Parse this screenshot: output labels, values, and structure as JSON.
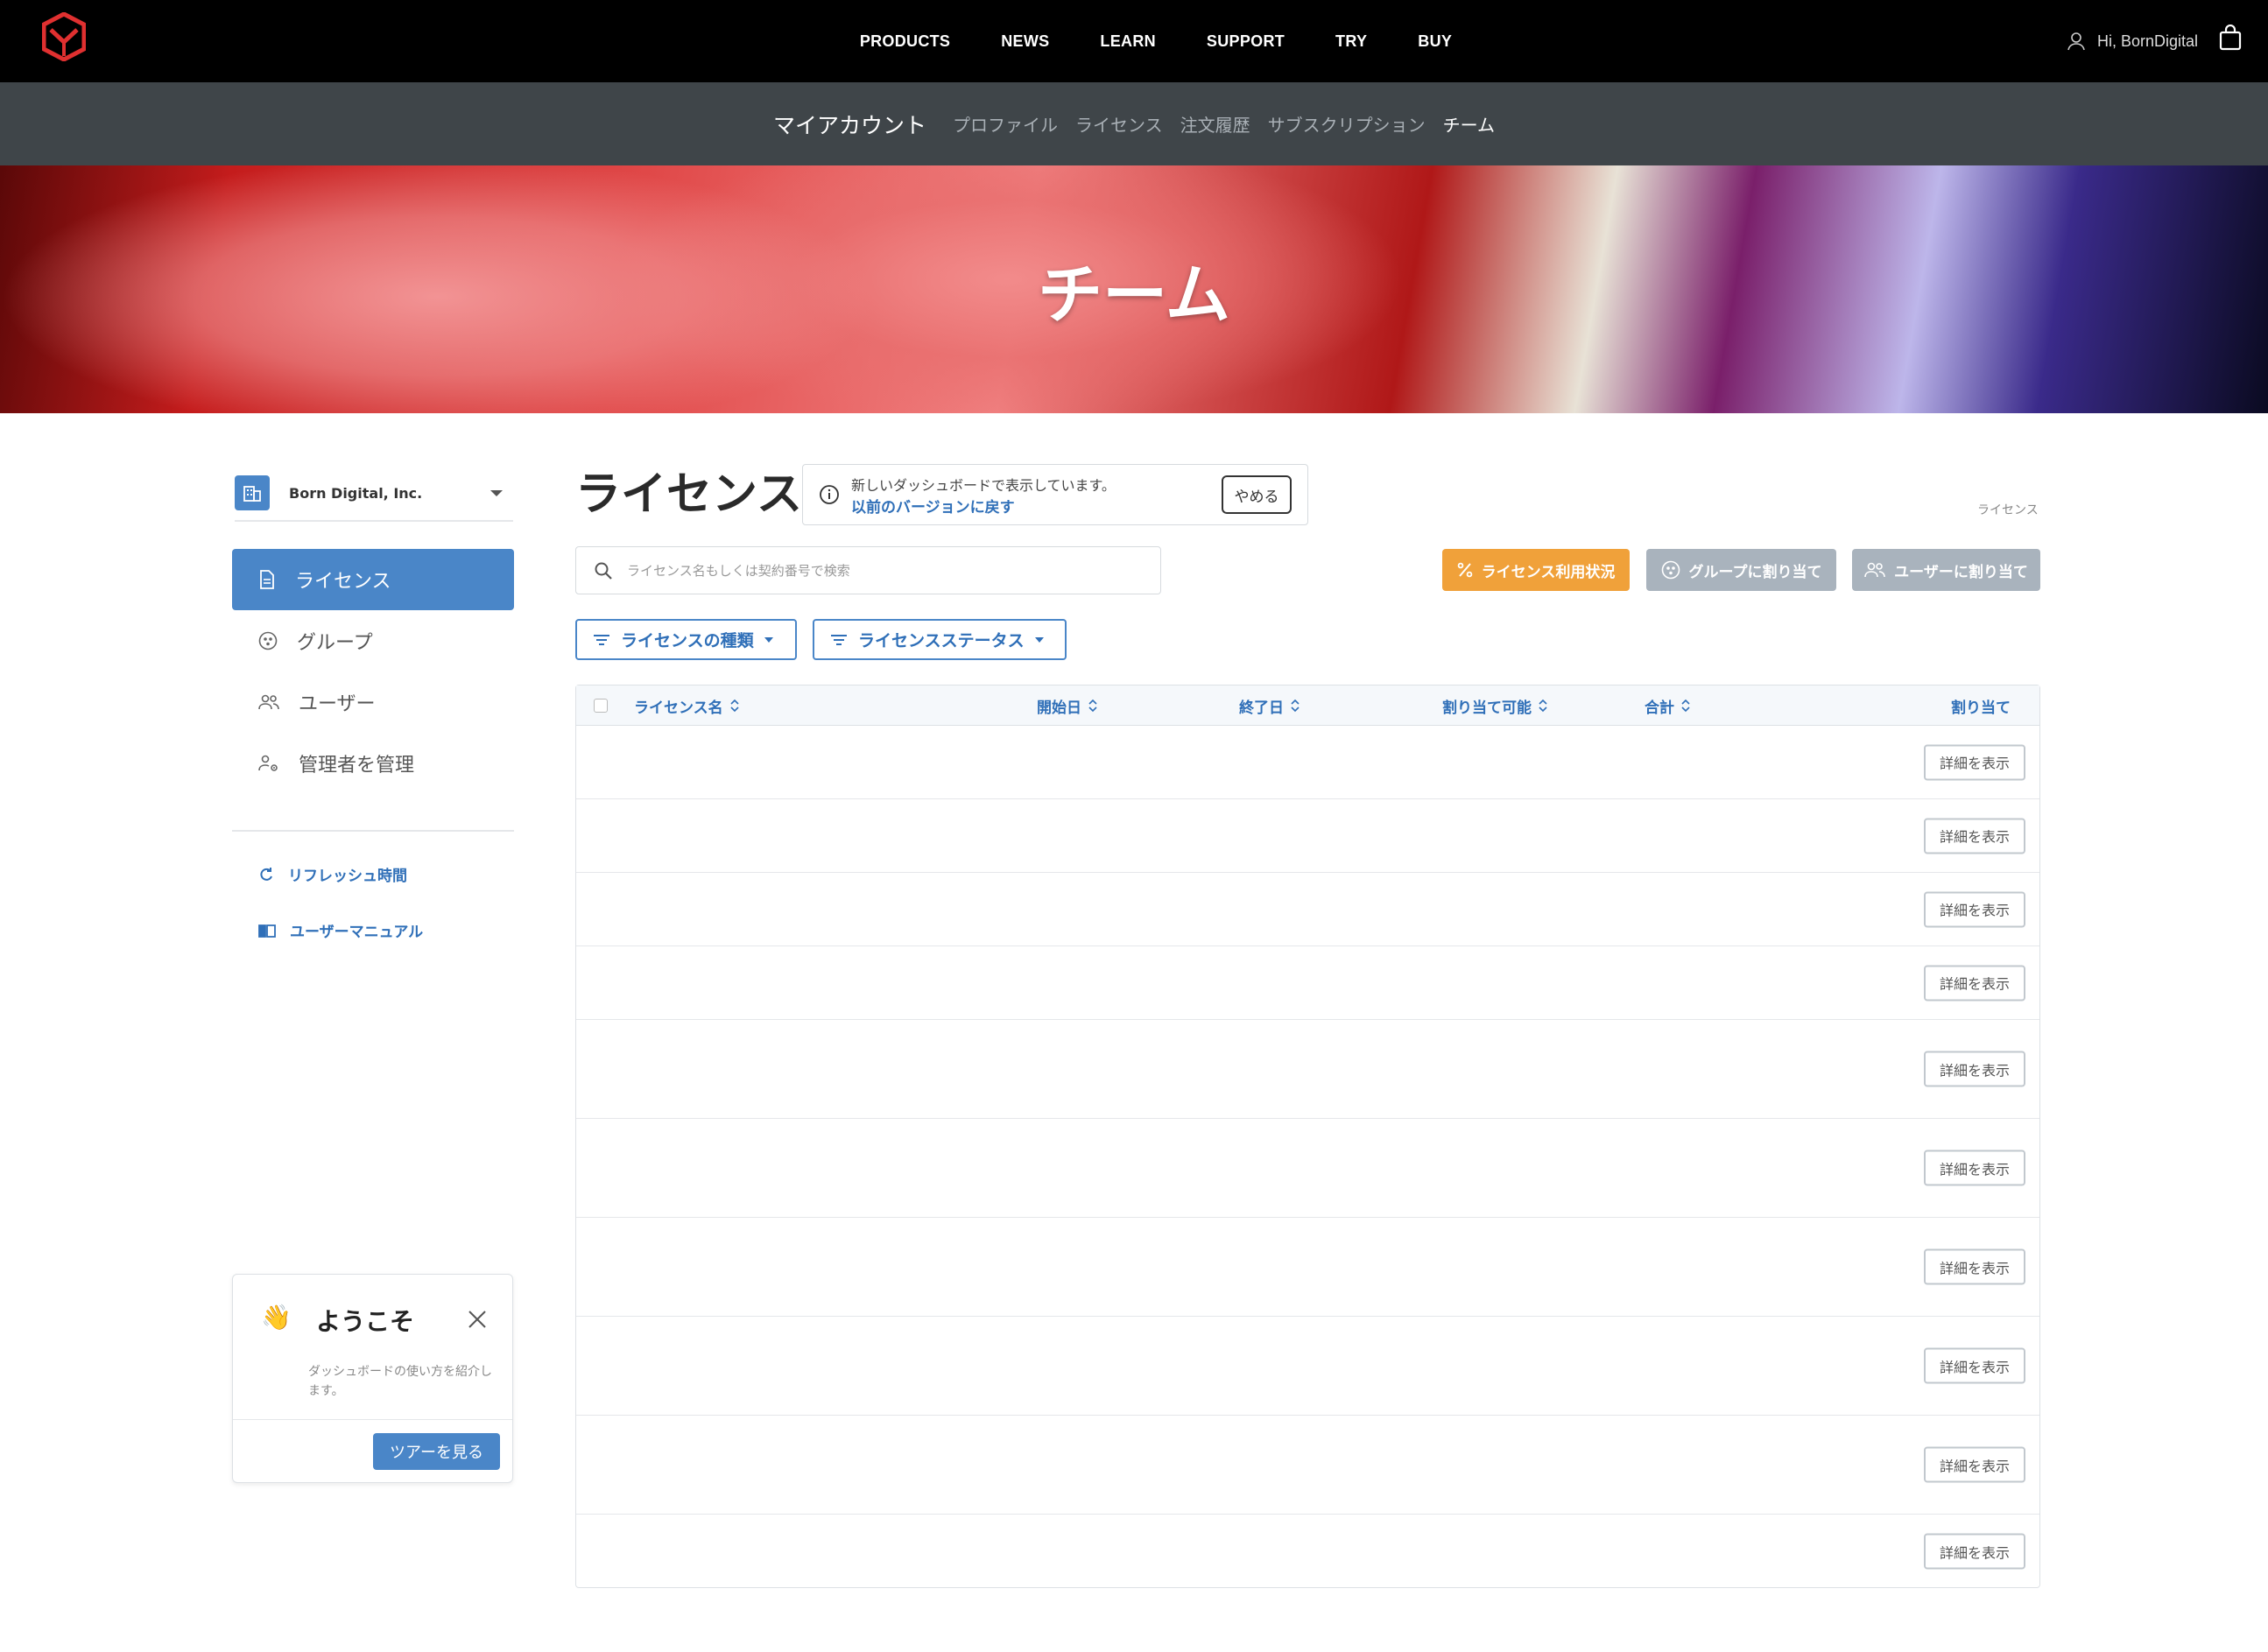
{
  "topnav": {
    "links": [
      "PRODUCTS",
      "NEWS",
      "LEARN",
      "SUPPORT",
      "TRY",
      "BUY"
    ],
    "greeting": "Hi, BornDigital"
  },
  "subnav": {
    "title": "マイアカウント",
    "items": [
      "プロファイル",
      "ライセンス",
      "注文履歴",
      "サブスクリプション",
      "チーム"
    ],
    "active_index": 4
  },
  "hero": {
    "title": "チーム"
  },
  "sidebar": {
    "org_name": "Born Digital, Inc.",
    "nav": [
      "ライセンス",
      "グループ",
      "ユーザー",
      "管理者を管理"
    ],
    "links": [
      "リフレッシュ時間",
      "ユーザーマニュアル"
    ]
  },
  "welcome": {
    "title": "ようこそ",
    "description": "ダッシュボードの使い方を紹介します。",
    "tour_button": "ツアーを見る"
  },
  "main": {
    "title": "ライセンス",
    "notice_line1": "新しいダッシュボードで表示しています。",
    "notice_link": "以前のバージョンに戻す",
    "notice_button": "やめる",
    "breadcrumb": "ライセンス",
    "search_placeholder": "ライセンス名もしくは契約番号で検索",
    "actions": {
      "usage": "ライセンス利用状況",
      "assign_group": "グループに割り当て",
      "assign_user": "ユーザーに割り当て"
    },
    "filters": [
      "ライセンスの種類",
      "ライセンスステータス"
    ],
    "table": {
      "columns": [
        "ライセンス名",
        "開始日",
        "終了日",
        "割り当て可能",
        "合計",
        "割り当て"
      ],
      "row_button": "詳細を表示",
      "row_count": 10
    }
  },
  "colors": {
    "accent_blue": "#4a86c8",
    "orange": "#f0a13a",
    "grey_button": "#a9b3bd",
    "topnav_bg": "#000000",
    "subnav_bg": "#3f4549"
  }
}
